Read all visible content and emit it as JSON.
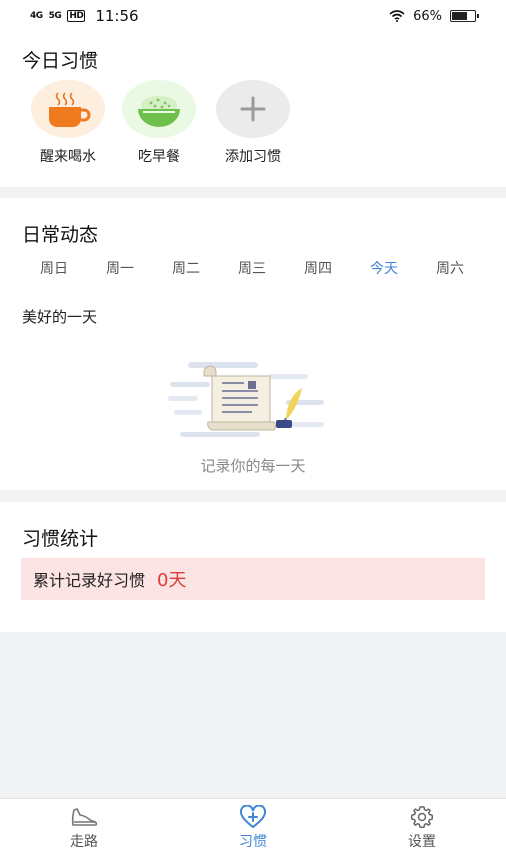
{
  "status_bar": {
    "signal_1": "4G",
    "signal_2": "5G",
    "hd": "HD",
    "time": "11:56",
    "battery": "66%",
    "battery_level": 0.66
  },
  "habits": {
    "title": "今日习惯",
    "items": [
      {
        "label": "醒来喝水",
        "icon": "coffee-cup-icon",
        "bg": "#fdeede"
      },
      {
        "label": "吃早餐",
        "icon": "rice-bowl-icon",
        "bg": "#e9f9e3"
      },
      {
        "label": "添加习惯",
        "icon": "plus-icon",
        "bg": "#ebebeb"
      }
    ]
  },
  "dynamics": {
    "title": "日常动态",
    "days": [
      "周日",
      "周一",
      "周二",
      "周三",
      "周四",
      "今天",
      "周六"
    ],
    "active_day": 5,
    "motto": "美好的一天",
    "empty_text": "记录你的每一天"
  },
  "stats": {
    "title": "习惯统计",
    "label": "累计记录好习惯",
    "value": "0天"
  },
  "tabbar": {
    "tabs": [
      {
        "label": "走路",
        "icon": "shoe-icon"
      },
      {
        "label": "习惯",
        "icon": "heart-plus-icon"
      },
      {
        "label": "设置",
        "icon": "gear-icon"
      }
    ],
    "active": 1
  },
  "colors": {
    "accent": "#3f86d6",
    "stat_value": "#e03a3a",
    "stat_bg": "#fde4e4"
  }
}
